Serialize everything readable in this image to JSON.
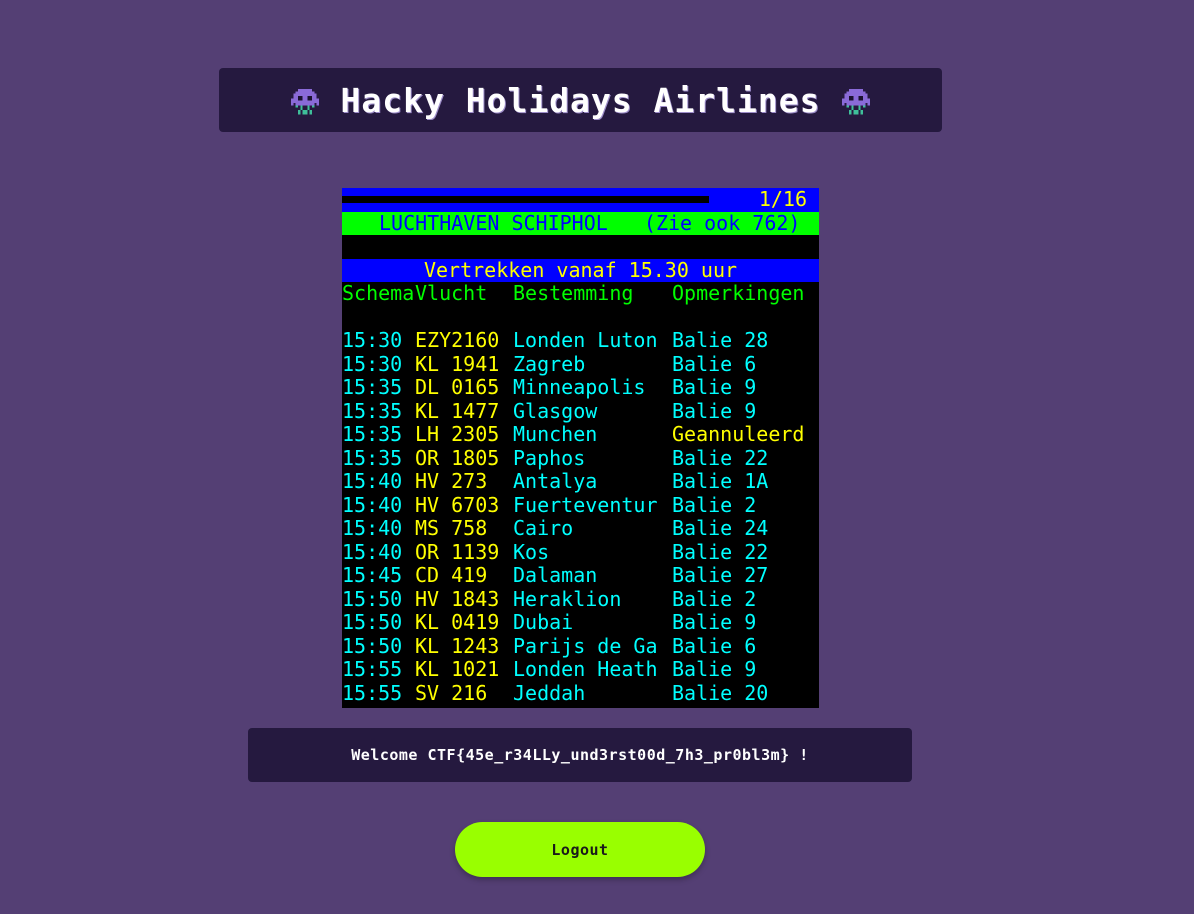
{
  "header": {
    "title": "Hacky Holidays Airlines",
    "icon_left": "alien-icon",
    "icon_right": "alien-icon"
  },
  "teletext": {
    "page_indicator": "1/16",
    "airport_line": "LUCHTHAVEN SCHIPHOL   (Zie ook 762)",
    "heading": "Vertrekken vanaf 15.30 uur",
    "columns": {
      "time": "Schema",
      "flight": "Vlucht",
      "destination": "Bestemming",
      "remarks": "Opmerkingen"
    },
    "flights": [
      {
        "time": "15:30",
        "flight": "EZY2160",
        "destination": "Londen Luton",
        "remarks": "Balie 28",
        "remarks_color": "cyan"
      },
      {
        "time": "15:30",
        "flight": "KL 1941",
        "destination": "Zagreb",
        "remarks": "Balie 6",
        "remarks_color": "cyan"
      },
      {
        "time": "15:35",
        "flight": "DL 0165",
        "destination": "Minneapolis",
        "remarks": "Balie 9",
        "remarks_color": "cyan"
      },
      {
        "time": "15:35",
        "flight": "KL 1477",
        "destination": "Glasgow",
        "remarks": "Balie 9",
        "remarks_color": "cyan"
      },
      {
        "time": "15:35",
        "flight": "LH 2305",
        "destination": "Munchen",
        "remarks": "Geannuleerd",
        "remarks_color": "yellow"
      },
      {
        "time": "15:35",
        "flight": "OR 1805",
        "destination": "Paphos",
        "remarks": "Balie 22",
        "remarks_color": "cyan"
      },
      {
        "time": "15:40",
        "flight": "HV 273",
        "destination": "Antalya",
        "remarks": "Balie 1A",
        "remarks_color": "cyan"
      },
      {
        "time": "15:40",
        "flight": "HV 6703",
        "destination": "Fuerteventur",
        "remarks": "Balie 2",
        "remarks_color": "cyan"
      },
      {
        "time": "15:40",
        "flight": "MS 758",
        "destination": "Cairo",
        "remarks": "Balie 24",
        "remarks_color": "cyan"
      },
      {
        "time": "15:40",
        "flight": "OR 1139",
        "destination": "Kos",
        "remarks": "Balie 22",
        "remarks_color": "cyan"
      },
      {
        "time": "15:45",
        "flight": "CD 419",
        "destination": "Dalaman",
        "remarks": "Balie 27",
        "remarks_color": "cyan"
      },
      {
        "time": "15:50",
        "flight": "HV 1843",
        "destination": "Heraklion",
        "remarks": "Balie 2",
        "remarks_color": "cyan"
      },
      {
        "time": "15:50",
        "flight": "KL 0419",
        "destination": "Dubai",
        "remarks": "Balie 9",
        "remarks_color": "cyan"
      },
      {
        "time": "15:50",
        "flight": "KL 1243",
        "destination": "Parijs de Ga",
        "remarks": "Balie 6",
        "remarks_color": "cyan"
      },
      {
        "time": "15:55",
        "flight": "KL 1021",
        "destination": "Londen Heath",
        "remarks": "Balie 9",
        "remarks_color": "cyan"
      },
      {
        "time": "15:55",
        "flight": "SV 216",
        "destination": "Jeddah",
        "remarks": "Balie 20",
        "remarks_color": "cyan"
      }
    ]
  },
  "welcome": {
    "text": "Welcome CTF{45e_r34LLy_und3rst00d_7h3_pr0bl3m} !"
  },
  "logout": {
    "label": "Logout"
  },
  "colors": {
    "background": "#543f74",
    "panel": "#25193f",
    "logout_button": "#99ff00",
    "teletext_blue": "#0000ff",
    "teletext_green": "#00ff00",
    "teletext_yellow": "#ffff00",
    "teletext_cyan": "#00ffff"
  }
}
